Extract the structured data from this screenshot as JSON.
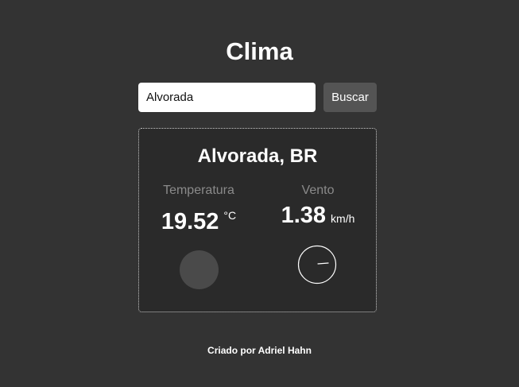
{
  "app": {
    "title": "Clima"
  },
  "search": {
    "value": "Alvorada",
    "button_label": "Buscar"
  },
  "weather": {
    "location": "Alvorada, BR",
    "temperature": {
      "label": "Temperatura",
      "value": "19.52",
      "unit": "°C"
    },
    "wind": {
      "label": "Vento",
      "value": "1.38",
      "unit": "km/h"
    }
  },
  "icons": {
    "temperature": "temperature-circle-icon",
    "wind": "wind-direction-compass-icon"
  },
  "colors": {
    "background": "#333333",
    "card": "#2a2a2a",
    "button": "#545454",
    "muted": "#8a8a8a"
  },
  "footer": {
    "text": "Criado por Adriel Hahn"
  }
}
